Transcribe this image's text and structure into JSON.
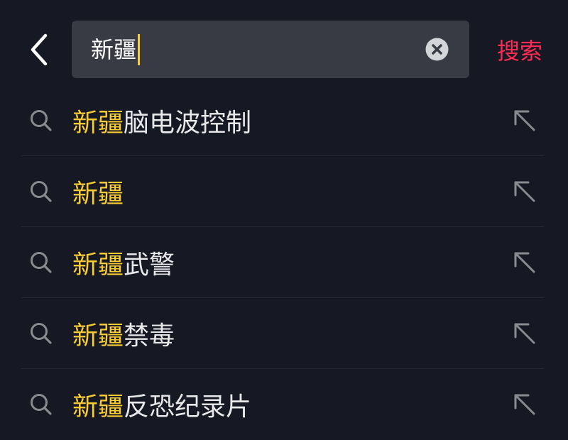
{
  "search": {
    "query": "新疆",
    "submit_label": "搜索"
  },
  "icons": {
    "back": "chevron-left-icon",
    "clear": "clear-circle-x-icon",
    "suggestion": "search-icon",
    "fill": "arrow-up-left-icon"
  },
  "colors": {
    "background": "#161823",
    "search_box": "#393b44",
    "highlight": "#facd34",
    "accent": "#fe2c55",
    "text": "#e8e8ea"
  },
  "suggestions": [
    {
      "match": "新疆",
      "rest": "脑电波控制"
    },
    {
      "match": "新疆",
      "rest": ""
    },
    {
      "match": "新疆",
      "rest": "武警"
    },
    {
      "match": "新疆",
      "rest": "禁毒"
    },
    {
      "match": "新疆",
      "rest": "反恐纪录片"
    }
  ]
}
